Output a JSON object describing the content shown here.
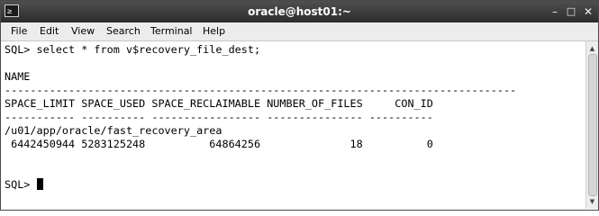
{
  "window": {
    "title": "oracle@host01:~",
    "icon": "terminal-icon",
    "icon_glyph": "≥",
    "controls": {
      "minimize": "–",
      "maximize": "□",
      "close": "✕"
    }
  },
  "menubar": {
    "items": [
      "File",
      "Edit",
      "View",
      "Search",
      "Terminal",
      "Help"
    ]
  },
  "terminal": {
    "lines": [
      "SQL> select * from v$recovery_file_dest;",
      "",
      "NAME",
      "--------------------------------------------------------------------------------",
      "SPACE_LIMIT SPACE_USED SPACE_RECLAIMABLE NUMBER_OF_FILES     CON_ID",
      "----------- ---------- ----------------- --------------- ----------",
      "/u01/app/oracle/fast_recovery_area",
      " 6442450944 5283125248          64864256              18          0",
      "",
      "",
      "SQL> "
    ]
  },
  "scrollbar": {
    "up_arrow": "▲",
    "down_arrow": "▼"
  },
  "colors": {
    "titlebar": "#3a3a3a",
    "menubar": "#ececec",
    "terminal_bg": "#ffffff",
    "terminal_fg": "#000000"
  }
}
